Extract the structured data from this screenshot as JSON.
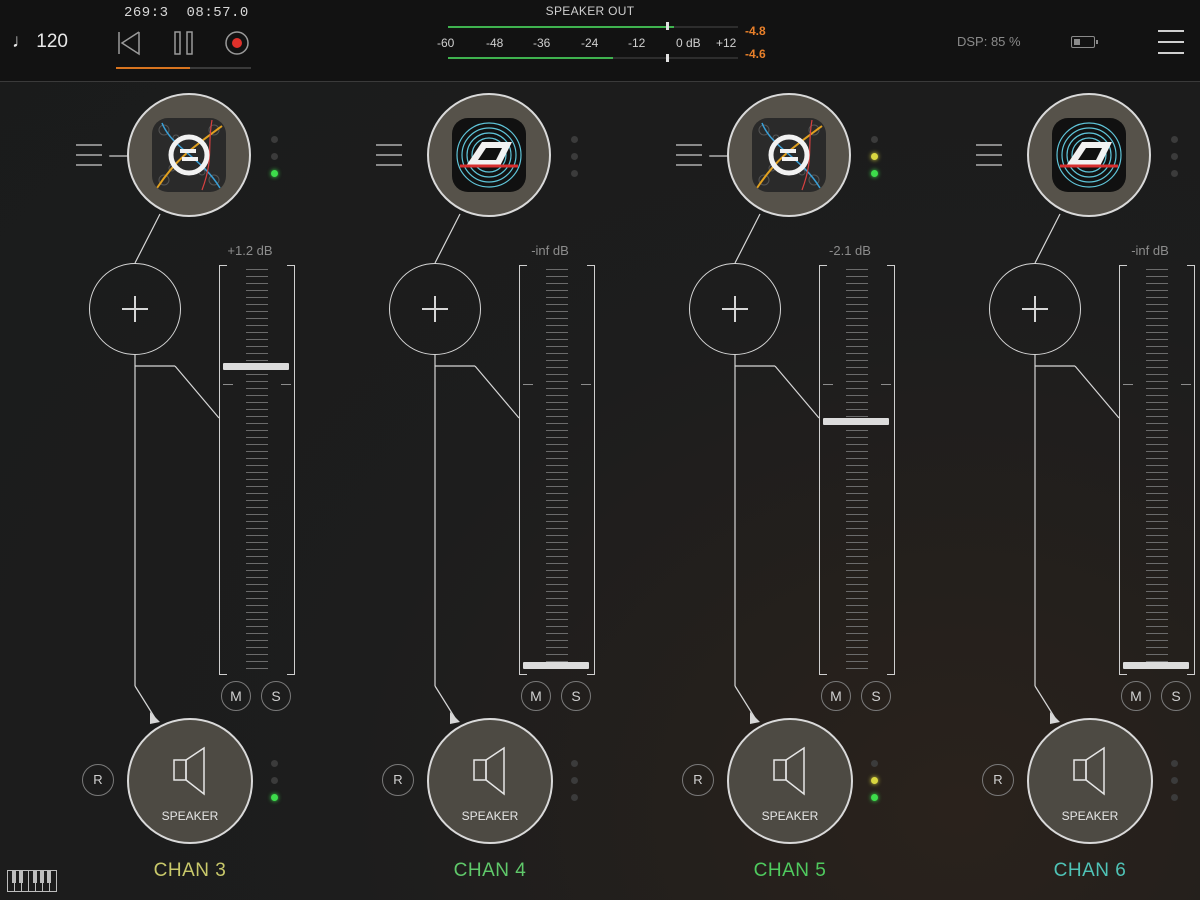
{
  "transport": {
    "tempo": "♩ 120",
    "position": "269:3",
    "time": "08:57.0",
    "progress": 0.55
  },
  "meter": {
    "title": "SPEAKER OUT",
    "scale": [
      "-60",
      "-48",
      "-36",
      "-24",
      "-12",
      "0 dB",
      "+12"
    ],
    "peak_top": "-4.8",
    "peak_bottom": "-4.6",
    "level_top": 0.78,
    "level_bottom": 0.57
  },
  "status": {
    "dsp": "DSP: 85 %",
    "battery_level": 0.35
  },
  "colors": {
    "accent_orange": "#d8741f",
    "meter_green": "#3fb34f",
    "led_green": "#3ddc4b",
    "led_yellow": "#d9d640"
  },
  "channels": [
    {
      "name": "CHAN 3",
      "color": "#c8c86a",
      "instrument": "modular-synth-icon",
      "gain": "+1.2 dB",
      "fader_level": 0.76,
      "top_leds": [
        "off",
        "off",
        "green"
      ],
      "bottom_leds": [
        "off",
        "off",
        "green"
      ],
      "has_menu_dot": true,
      "mute": "M",
      "solo": "S",
      "rec": "R",
      "output": "SPEAKER"
    },
    {
      "name": "CHAN 4",
      "color": "#5fc86a",
      "instrument": "ruismaker-icon",
      "gain": "-inf dB",
      "fader_level": 0.0,
      "top_leds": [
        "off",
        "off",
        "off"
      ],
      "bottom_leds": [
        "off",
        "off",
        "off"
      ],
      "has_menu_dot": false,
      "mute": "M",
      "solo": "S",
      "rec": "R",
      "output": "SPEAKER"
    },
    {
      "name": "CHAN 5",
      "color": "#4fca5e",
      "instrument": "modular-synth-icon",
      "gain": "-2.1 dB",
      "fader_level": 0.62,
      "top_leds": [
        "off",
        "yellow",
        "green"
      ],
      "bottom_leds": [
        "off",
        "yellow",
        "green"
      ],
      "has_menu_dot": true,
      "mute": "M",
      "solo": "S",
      "rec": "R",
      "output": "SPEAKER"
    },
    {
      "name": "CHAN 6",
      "color": "#4fc3b6",
      "instrument": "ruismaker-icon",
      "gain": "-inf dB",
      "fader_level": 0.0,
      "top_leds": [
        "off",
        "off",
        "off"
      ],
      "bottom_leds": [
        "off",
        "off",
        "off"
      ],
      "has_menu_dot": false,
      "mute": "M",
      "solo": "S",
      "rec": "R",
      "output": "SPEAKER"
    }
  ]
}
